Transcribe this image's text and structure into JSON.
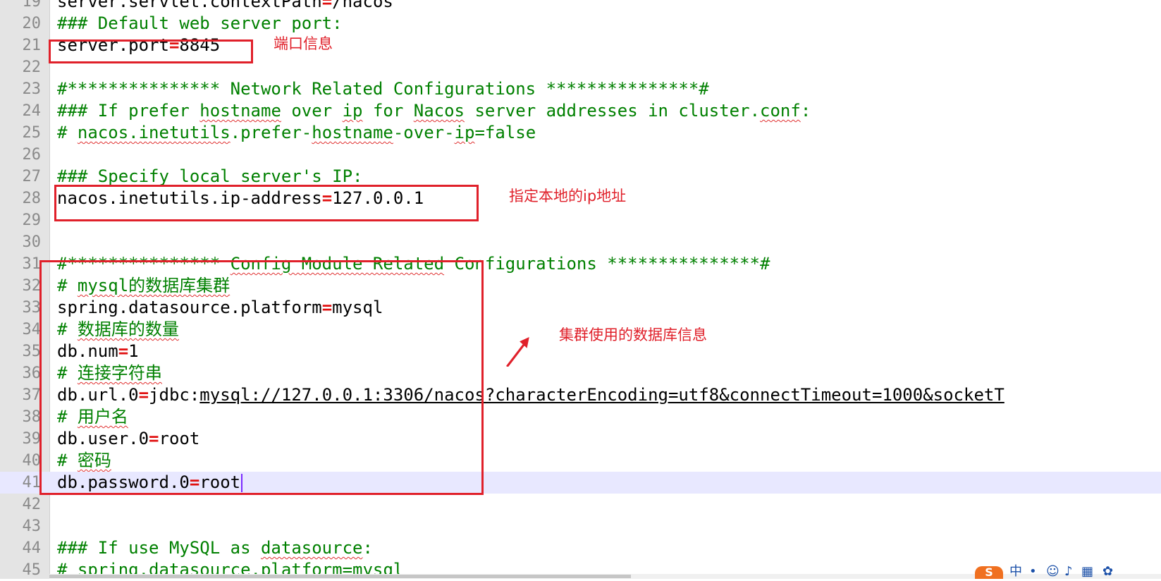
{
  "editor": {
    "lines": [
      {
        "num": "19",
        "segments": [
          {
            "t": "server.servlet.contextPath",
            "c": "plain"
          },
          {
            "t": "=",
            "c": "eq"
          },
          {
            "t": "/nacos",
            "c": "plain"
          }
        ]
      },
      {
        "num": "20",
        "segments": [
          {
            "t": "### Default web server port:",
            "c": "cm"
          }
        ]
      },
      {
        "num": "21",
        "segments": [
          {
            "t": "server.port",
            "c": "plain"
          },
          {
            "t": "=",
            "c": "eq"
          },
          {
            "t": "8845",
            "c": "plain"
          }
        ]
      },
      {
        "num": "22",
        "segments": []
      },
      {
        "num": "23",
        "segments": [
          {
            "t": "#*************** Network Related Configurations ***************#",
            "c": "cm"
          }
        ]
      },
      {
        "num": "24",
        "segments": [
          {
            "t": "### If prefer ",
            "c": "cm"
          },
          {
            "t": "hostname",
            "c": "cmu"
          },
          {
            "t": " over ",
            "c": "cm"
          },
          {
            "t": "ip",
            "c": "cmu"
          },
          {
            "t": " for ",
            "c": "cm"
          },
          {
            "t": "Nacos",
            "c": "cmu"
          },
          {
            "t": " server addresses in cluster.",
            "c": "cm"
          },
          {
            "t": "conf",
            "c": "cmu"
          },
          {
            "t": ":",
            "c": "cm"
          }
        ]
      },
      {
        "num": "25",
        "segments": [
          {
            "t": "# ",
            "c": "cm"
          },
          {
            "t": "nacos.inetutils",
            "c": "cmu"
          },
          {
            "t": ".prefer-",
            "c": "cm"
          },
          {
            "t": "hostname",
            "c": "cmu"
          },
          {
            "t": "-over-",
            "c": "cm"
          },
          {
            "t": "ip",
            "c": "cmu"
          },
          {
            "t": "=false",
            "c": "cm"
          }
        ]
      },
      {
        "num": "26",
        "segments": []
      },
      {
        "num": "27",
        "segments": [
          {
            "t": "### Specify local server's IP:",
            "c": "cm"
          }
        ]
      },
      {
        "num": "28",
        "segments": [
          {
            "t": "nacos.inetutils.ip-address",
            "c": "plain"
          },
          {
            "t": "=",
            "c": "eq"
          },
          {
            "t": "127.0.0.1",
            "c": "plain"
          }
        ]
      },
      {
        "num": "29",
        "segments": []
      },
      {
        "num": "30",
        "segments": []
      },
      {
        "num": "31",
        "segments": [
          {
            "t": "#*************** ",
            "c": "cm"
          },
          {
            "t": "Config Module Related",
            "c": "cmu"
          },
          {
            "t": " Configurations ***************#",
            "c": "cm"
          }
        ]
      },
      {
        "num": "32",
        "segments": [
          {
            "t": "# ",
            "c": "cm"
          },
          {
            "t": "mysql的数据库集群",
            "c": "cmu"
          }
        ]
      },
      {
        "num": "33",
        "segments": [
          {
            "t": "spring.datasource.platform",
            "c": "plain"
          },
          {
            "t": "=",
            "c": "eq"
          },
          {
            "t": "mysql",
            "c": "plain"
          }
        ]
      },
      {
        "num": "34",
        "segments": [
          {
            "t": "# ",
            "c": "cm"
          },
          {
            "t": "数据库的数量",
            "c": "cmu"
          }
        ]
      },
      {
        "num": "35",
        "segments": [
          {
            "t": "db.num",
            "c": "plain"
          },
          {
            "t": "=",
            "c": "eq"
          },
          {
            "t": "1",
            "c": "plain"
          }
        ]
      },
      {
        "num": "36",
        "segments": [
          {
            "t": "# ",
            "c": "cm"
          },
          {
            "t": "连接字符串",
            "c": "cmu"
          }
        ]
      },
      {
        "num": "37",
        "segments": [
          {
            "t": "db.url.0",
            "c": "plain"
          },
          {
            "t": "=",
            "c": "eq"
          },
          {
            "t": "jdbc:",
            "c": "plain"
          },
          {
            "t": "mysql://127.0.0.1:3306/nacos?characterEncoding=utf8&connectTimeout=1000&socketT",
            "c": "link"
          }
        ]
      },
      {
        "num": "38",
        "segments": [
          {
            "t": "# ",
            "c": "cm"
          },
          {
            "t": "用户名",
            "c": "cmu"
          }
        ]
      },
      {
        "num": "39",
        "segments": [
          {
            "t": "db.user.0",
            "c": "plain"
          },
          {
            "t": "=",
            "c": "eq"
          },
          {
            "t": "root",
            "c": "plain"
          }
        ]
      },
      {
        "num": "40",
        "segments": [
          {
            "t": "# ",
            "c": "cm"
          },
          {
            "t": "密码",
            "c": "cmu"
          }
        ]
      },
      {
        "num": "41",
        "segments": [
          {
            "t": "db.password.0",
            "c": "plain"
          },
          {
            "t": "=",
            "c": "eq"
          },
          {
            "t": "root",
            "c": "plain"
          }
        ],
        "current": true
      },
      {
        "num": "42",
        "segments": []
      },
      {
        "num": "43",
        "segments": []
      },
      {
        "num": "44",
        "segments": [
          {
            "t": "### If use MySQL as ",
            "c": "cm"
          },
          {
            "t": "datasource",
            "c": "cmu"
          },
          {
            "t": ":",
            "c": "cm"
          }
        ]
      },
      {
        "num": "45",
        "segments": [
          {
            "t": "# spring.datasource.platform=mysql",
            "c": "cm"
          }
        ]
      }
    ]
  },
  "annotations": {
    "port_note": "端口信息",
    "ip_note": "指定本地的ip地址",
    "cluster_db_note": "集群使用的数据库信息"
  },
  "colors": {
    "comment": "#008000",
    "operator": "#e01010",
    "annotation": "#e0202a",
    "current_line": "#e8e8ff",
    "gutter": "#e4e4e4"
  },
  "taskbar": {
    "ime_label": "S",
    "ime_lang": "中",
    "icons": [
      "sogou-ime-icon",
      "punctuation-icon",
      "emoji-icon",
      "mic-icon",
      "keyboard-icon",
      "skin-icon"
    ]
  }
}
